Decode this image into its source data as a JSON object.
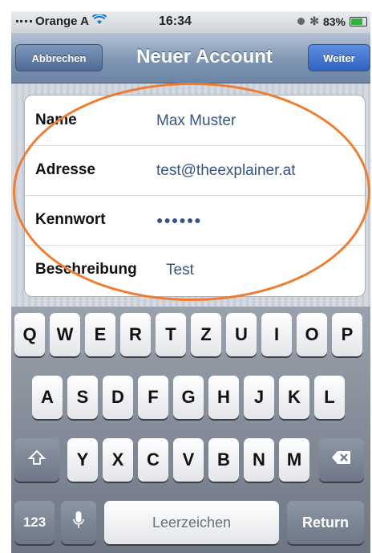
{
  "status_bar": {
    "carrier": "Orange A",
    "time": "16:34",
    "battery": "83%",
    "icons": [
      "signal-icon",
      "wifi-icon",
      "alarm-icon",
      "bluetooth-icon",
      "battery-icon"
    ]
  },
  "nav": {
    "cancel_label": "Abbrechen",
    "title": "Neuer Account",
    "next_label": "Weiter"
  },
  "form": {
    "rows": [
      {
        "label": "Name",
        "value": "Max Muster"
      },
      {
        "label": "Adresse",
        "value": "test@theexplainer.at"
      },
      {
        "label": "Kennwort",
        "value": "●●●●●●"
      },
      {
        "label": "Beschreibung",
        "value": "Test"
      }
    ]
  },
  "keyboard": {
    "row1": [
      "Q",
      "W",
      "E",
      "R",
      "T",
      "Z",
      "U",
      "I",
      "O",
      "P"
    ],
    "row2": [
      "A",
      "S",
      "D",
      "F",
      "G",
      "H",
      "J",
      "K",
      "L"
    ],
    "row3": [
      "Y",
      "X",
      "C",
      "V",
      "B",
      "N",
      "M"
    ],
    "numbers_label": "123",
    "space_label": "Leerzeichen",
    "return_label": "Return",
    "shift_icon": "shift-icon",
    "delete_icon": "delete-icon",
    "mic_icon": "microphone-icon"
  },
  "annotation_color": "#ef7d31"
}
